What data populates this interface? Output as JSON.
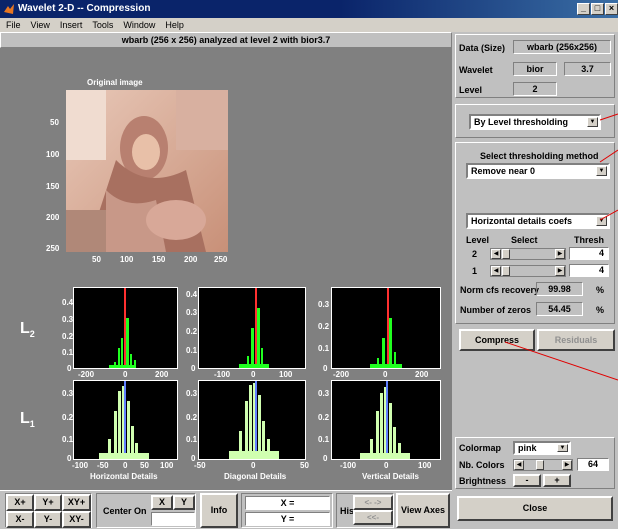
{
  "window": {
    "title": "Wavelet 2-D  --  Compression",
    "min_glyph": "_",
    "max_glyph": "□",
    "close_glyph": "×"
  },
  "menu": [
    "File",
    "View",
    "Insert",
    "Tools",
    "Window",
    "Help"
  ],
  "status": "wbarb (256 x 256) analyzed at level 2 with bior3.7",
  "image_panel": {
    "title": "Original image",
    "yticks": [
      "50",
      "100",
      "150",
      "200",
      "250"
    ],
    "xticks": [
      "50",
      "100",
      "150",
      "200",
      "250"
    ]
  },
  "row_labels": {
    "level2": "L",
    "level2_sub": "2",
    "level1": "L",
    "level1_sub": "1"
  },
  "histograms": {
    "l2_h": {
      "yticks": [
        "0.4",
        "0.3",
        "0.2",
        "0.1",
        "0"
      ],
      "xticks": [
        "-200",
        "0",
        "200"
      ]
    },
    "l2_d": {
      "yticks": [
        "0.4",
        "0.3",
        "0.2",
        "0.1",
        "0"
      ],
      "xticks": [
        "-100",
        "0",
        "100"
      ]
    },
    "l2_v": {
      "yticks": [
        "0.3",
        "0.2",
        "0.1",
        "0"
      ],
      "xticks": [
        "-200",
        "0",
        "200"
      ]
    },
    "l1_h": {
      "yticks": [
        "0.3",
        "0.2",
        "0.1",
        "0"
      ],
      "xticks": [
        "-100",
        "-50",
        "0",
        "50",
        "100"
      ],
      "xlabel": "Horizontal Details"
    },
    "l1_d": {
      "yticks": [
        "0.3",
        "0.2",
        "0.1",
        "0"
      ],
      "xticks": [
        "-50",
        "0",
        "50"
      ],
      "xlabel": "Diagonal Details"
    },
    "l1_v": {
      "yticks": [
        "0.3",
        "0.2",
        "0.1",
        "0"
      ],
      "xticks": [
        "-100",
        "0",
        "100"
      ],
      "xlabel": "Vertical Details"
    }
  },
  "info_panel": {
    "data_label": "Data  (Size)",
    "data_value": "wbarb  (256x256)",
    "wavelet_label": "Wavelet",
    "wavelet_family": "bior",
    "wavelet_number": "3.7",
    "level_label": "Level",
    "level_value": "2"
  },
  "threshold_mode": "By Level thresholding",
  "method_panel": {
    "title": "Select thresholding method",
    "method": "Remove near 0",
    "coefs": "Horizontal details coefs",
    "col_level": "Level",
    "col_select": "Select",
    "col_thresh": "Thresh",
    "rows": [
      {
        "level": "2",
        "thresh": "4"
      },
      {
        "level": "1",
        "thresh": "4"
      }
    ],
    "norm_label": "Norm cfs recovery",
    "norm_value": "99.98",
    "norm_unit": "%",
    "zeros_label": "Number of zeros",
    "zeros_value": "54.45",
    "zeros_unit": "%"
  },
  "compress_label": "Compress",
  "residuals_label": "Residuals",
  "colormap_panel": {
    "colormap_label": "Colormap",
    "colormap_value": "pink",
    "nbcolors_label": "Nb. Colors",
    "nbcolors_value": "64",
    "brightness_label": "Brightness",
    "minus": "-",
    "plus": "+"
  },
  "close_label": "Close",
  "toolbar": {
    "xplus": "X+",
    "yplus": "Y+",
    "xyplus": "XY+",
    "xminus": "X-",
    "yminus": "Y-",
    "xyminus": "XY-",
    "center_on": "Center On",
    "x": "X",
    "y": "Y",
    "info": "Info",
    "x_eq": "X =",
    "y_eq": "Y =",
    "history": "History",
    "hist_fwd": "<-  ->",
    "hist_back": "<<-",
    "view_axes": "View Axes"
  }
}
